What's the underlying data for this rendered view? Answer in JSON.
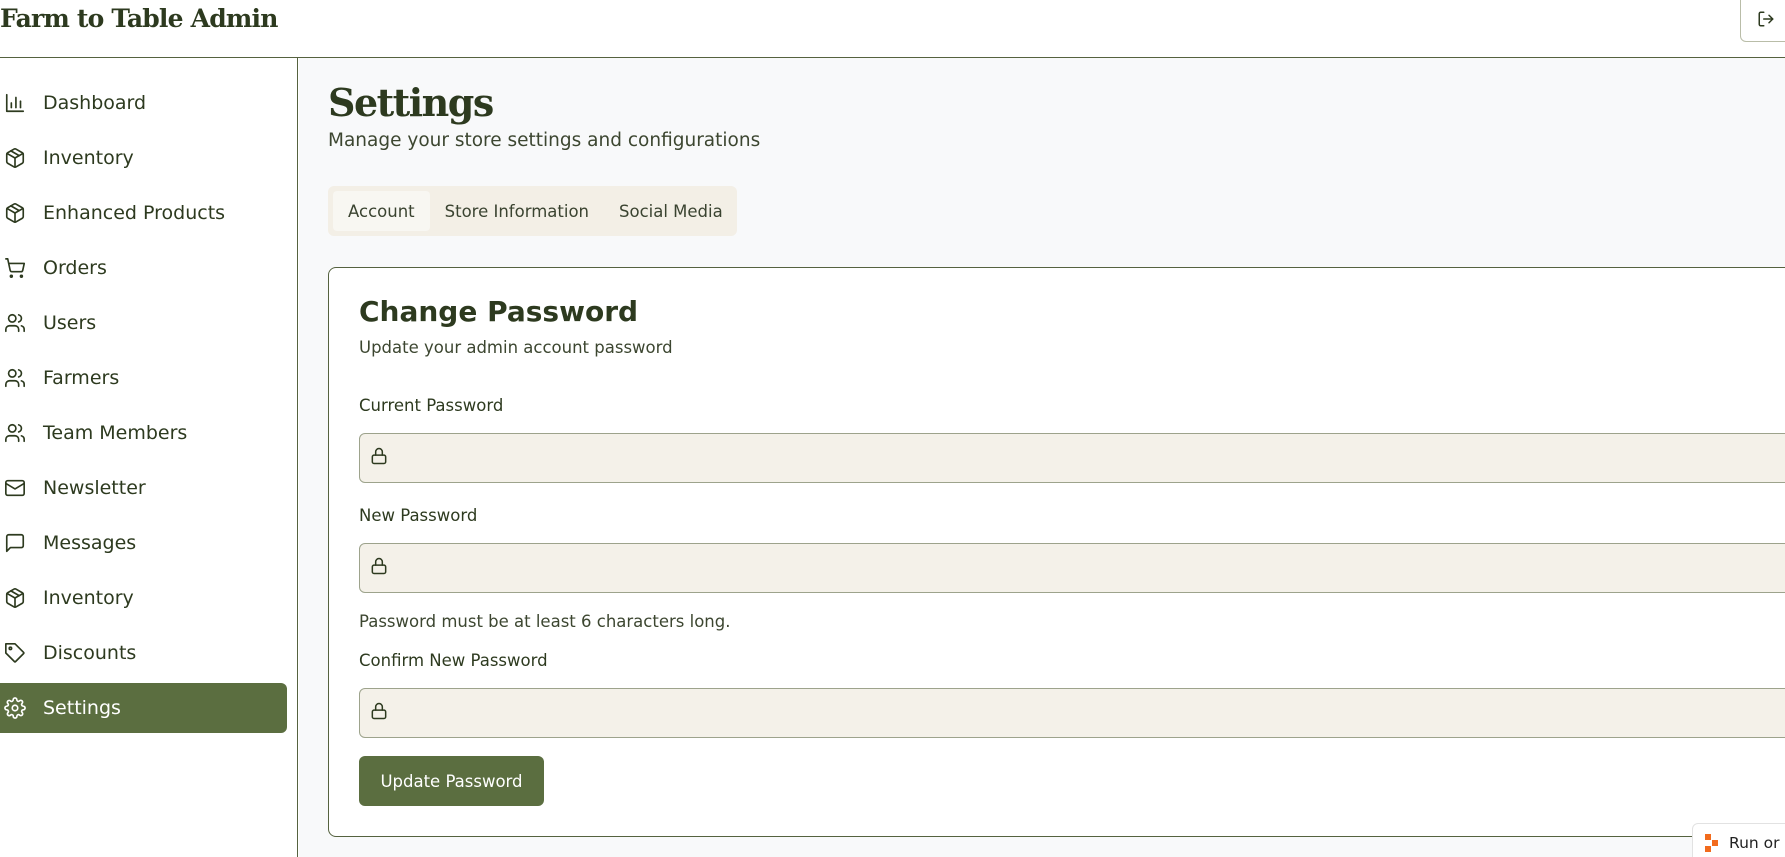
{
  "header": {
    "app_title": "Farm to Table Admin",
    "logout_icon": "logout-icon"
  },
  "sidebar": {
    "items": [
      {
        "label": "Dashboard",
        "icon": "bar-chart-icon",
        "active": false
      },
      {
        "label": "Inventory",
        "icon": "box-icon",
        "active": false
      },
      {
        "label": "Enhanced Products",
        "icon": "box-icon",
        "active": false
      },
      {
        "label": "Orders",
        "icon": "cart-icon",
        "active": false
      },
      {
        "label": "Users",
        "icon": "users-icon",
        "active": false
      },
      {
        "label": "Farmers",
        "icon": "users-icon",
        "active": false
      },
      {
        "label": "Team Members",
        "icon": "users-icon",
        "active": false
      },
      {
        "label": "Newsletter",
        "icon": "mail-icon",
        "active": false
      },
      {
        "label": "Messages",
        "icon": "message-icon",
        "active": false
      },
      {
        "label": "Inventory",
        "icon": "box-icon",
        "active": false
      },
      {
        "label": "Discounts",
        "icon": "tag-icon",
        "active": false
      },
      {
        "label": "Settings",
        "icon": "gear-icon",
        "active": true
      }
    ]
  },
  "main": {
    "title": "Settings",
    "subtitle": "Manage your store settings and configurations",
    "tabs": [
      {
        "label": "Account",
        "active": true
      },
      {
        "label": "Store Information",
        "active": false
      },
      {
        "label": "Social Media",
        "active": false
      }
    ],
    "card": {
      "title": "Change Password",
      "description": "Update your admin account password",
      "current_password_label": "Current Password",
      "current_password_value": "",
      "new_password_label": "New Password",
      "new_password_value": "",
      "new_password_hint": "Password must be at least 6 characters long.",
      "confirm_password_label": "Confirm New Password",
      "confirm_password_value": "",
      "submit_label": "Update Password"
    }
  },
  "badge": {
    "label": "Run or"
  },
  "colors": {
    "accent": "#5b6e40",
    "text_dark": "#2d3a1f",
    "field_bg": "#f4f1e9",
    "tabs_bg": "#f3efe6",
    "main_bg": "#f8f9fa"
  }
}
